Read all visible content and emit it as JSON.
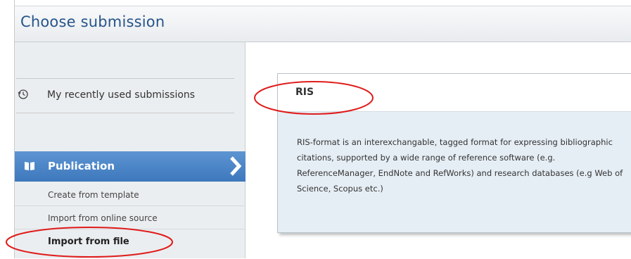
{
  "header": {
    "title": "Choose submission"
  },
  "sidebar": {
    "recent_label": "My recently used submissions",
    "category_label": "Publication",
    "items": [
      {
        "label": "Create from template"
      },
      {
        "label": "Import from online source"
      },
      {
        "label": "Import from file"
      }
    ]
  },
  "card": {
    "title": "RIS",
    "description": "RIS-format is an interexchangable, tagged format for expressing bibliographic citations, supported by a wide range of reference software (e.g. ReferenceManager, EndNote and RefWorks) and research databases (e.g Web of Science, Scopus etc.)"
  },
  "colors": {
    "title_blue": "#27548a",
    "publication_bar": "#4a86c8",
    "annotation_red": "#e01b1b"
  },
  "icons": [
    "clock-history-icon",
    "book-icon",
    "chevron-right-icon"
  ]
}
